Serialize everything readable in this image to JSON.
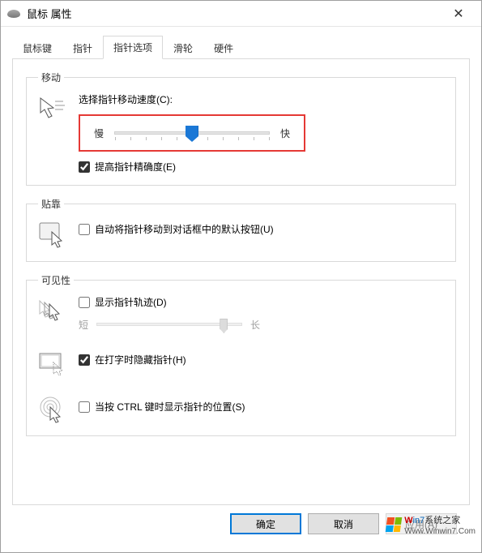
{
  "window": {
    "title": "鼠标 属性",
    "close_glyph": "✕"
  },
  "tabs": {
    "items": [
      {
        "label": "鼠标键"
      },
      {
        "label": "指针"
      },
      {
        "label": "指针选项"
      },
      {
        "label": "滑轮"
      },
      {
        "label": "硬件"
      }
    ],
    "active_index": 2
  },
  "motion": {
    "legend": "移动",
    "speed_label": "选择指针移动速度(C):",
    "slow": "慢",
    "fast": "快",
    "speed_value": 5,
    "speed_min": 0,
    "speed_max": 10,
    "enhance_precision_label": "提高指针精确度(E)",
    "enhance_precision_checked": true
  },
  "snapto": {
    "legend": "贴靠",
    "label": "自动将指针移动到对话框中的默认按钮(U)",
    "checked": false
  },
  "visibility": {
    "legend": "可见性",
    "trails_label": "显示指针轨迹(D)",
    "trails_checked": false,
    "trails_short": "短",
    "trails_long": "长",
    "hide_typing_label": "在打字时隐藏指针(H)",
    "hide_typing_checked": true,
    "ctrl_locate_label": "当按 CTRL 键时显示指针的位置(S)",
    "ctrl_locate_checked": false
  },
  "footer": {
    "ok": "确定",
    "cancel": "取消",
    "apply": "应用(A)"
  },
  "watermark": {
    "brand_w": "W",
    "brand_rest": "in7",
    "brand_tail": "系统之家",
    "url": "Www.Winwin7.Com"
  }
}
